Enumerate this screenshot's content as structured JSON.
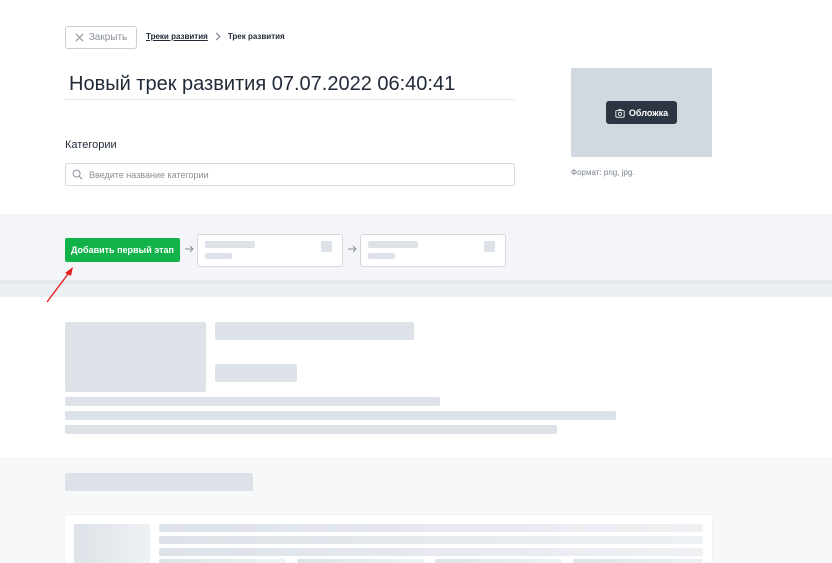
{
  "header": {
    "close_label": "Закрыть",
    "breadcrumb": {
      "parent": "Треки развития",
      "current": "Трек развития"
    }
  },
  "track": {
    "title_value": "Новый трек развития 07.07.2022 06:40:41"
  },
  "cover": {
    "button_label": "Обложка",
    "format_note": "Формат: png, jpg."
  },
  "categories": {
    "label": "Категории",
    "placeholder": "Введите название категории"
  },
  "stages": {
    "add_first_label": "Добавить первый этап"
  },
  "colors": {
    "accent_green": "#12b24a",
    "dark_button": "#2c3542",
    "skeleton": "#dde2e8",
    "annotation_red": "#e0201c"
  },
  "icons": {
    "close": "close-icon",
    "chevron": "chevron-right-icon",
    "camera": "camera-icon",
    "search": "search-icon",
    "arrow": "arrow-right-icon"
  }
}
